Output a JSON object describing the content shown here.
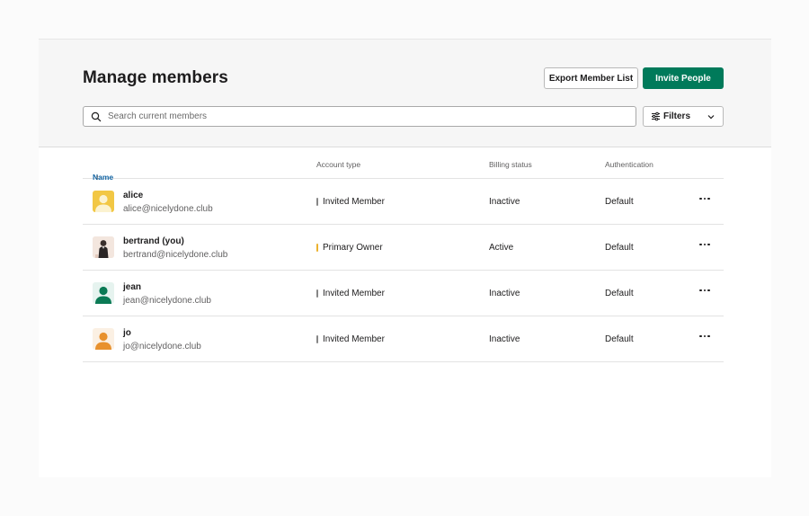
{
  "page": {
    "title": "Manage members",
    "export_label": "Export Member List",
    "invite_label": "Invite People"
  },
  "search": {
    "placeholder": "Search current members",
    "value": ""
  },
  "filters": {
    "label": "Filters"
  },
  "table": {
    "headers": {
      "name": "Name",
      "name_sort_indicator": "↑",
      "account_type": "Account type",
      "billing_status": "Billing status",
      "authentication": "Authentication"
    },
    "rows": [
      {
        "name": "alice",
        "email": "alice@nicelydone.club",
        "account_type": "Invited Member",
        "billing_status": "Inactive",
        "authentication": "Default",
        "avatar": "person-icon",
        "avatar_bg": "#f2c744",
        "avatar_fg": "#fbf2d0",
        "role_color": "#868686"
      },
      {
        "name": "bertrand (you)",
        "email": "bertrand@nicelydone.club",
        "account_type": "Primary Owner",
        "billing_status": "Active",
        "authentication": "Default",
        "avatar": "photo",
        "avatar_bg": "#f3e6de",
        "avatar_fg": "#2a2525",
        "role_color": "#ecb22e"
      },
      {
        "name": "jean",
        "email": "jean@nicelydone.club",
        "account_type": "Invited Member",
        "billing_status": "Inactive",
        "authentication": "Default",
        "avatar": "person-icon",
        "avatar_bg": "#e6f3ef",
        "avatar_fg": "#0b7a55",
        "role_color": "#868686"
      },
      {
        "name": "jo",
        "email": "jo@nicelydone.club",
        "account_type": "Invited Member",
        "billing_status": "Inactive",
        "authentication": "Default",
        "avatar": "person-icon",
        "avatar_bg": "#fbf0e3",
        "avatar_fg": "#e8912d",
        "role_color": "#868686"
      }
    ]
  },
  "colors": {
    "primary_button": "#007a5a",
    "link": "#1264a3",
    "owner_accent": "#ecb22e"
  }
}
